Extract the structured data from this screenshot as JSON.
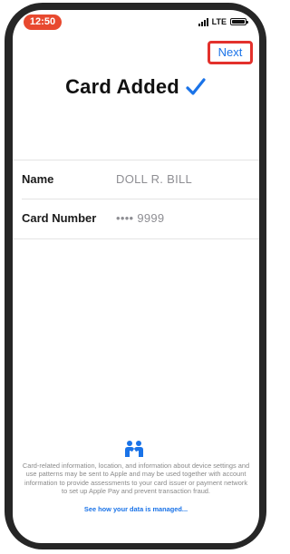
{
  "status_bar": {
    "time": "12:50",
    "network": "LTE",
    "time_pill_color": "#e8492f"
  },
  "header": {
    "next_label": "Next",
    "highlight_color": "#e3312c",
    "link_color": "#1a73e8"
  },
  "title": {
    "text": "Card Added",
    "check_icon": "checkmark-icon",
    "check_color": "#1a73e8"
  },
  "details": [
    {
      "label": "Name",
      "value": "DOLL R. BILL"
    },
    {
      "label": "Card Number",
      "value": "•••• 9999"
    }
  ],
  "footer": {
    "icon": "people-handshake-icon",
    "disclaimer": "Card-related information, location, and information about device settings and use patterns may be sent to Apple and may be used together with account information to provide assessments to your card issuer or payment network to set up Apple Pay and prevent transaction fraud.",
    "link": "See how your data is managed..."
  }
}
